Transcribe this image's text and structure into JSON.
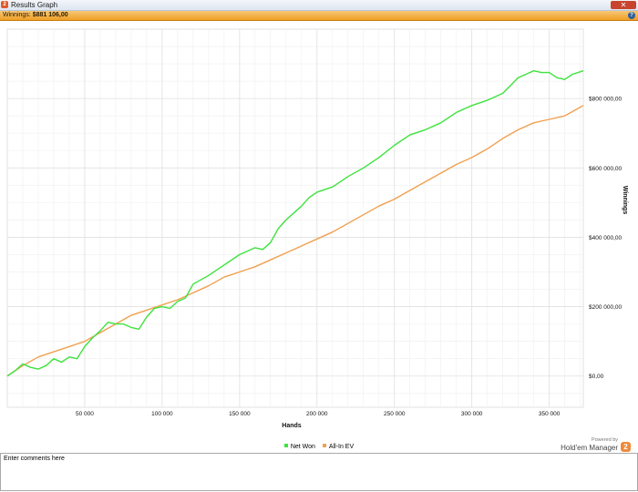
{
  "window": {
    "title": "Results Graph",
    "close_label": "✕",
    "icon_label": "2"
  },
  "info_bar": {
    "label": "Winnings:",
    "value": "$881 106,00",
    "help_label": "?"
  },
  "chart_data": {
    "type": "line",
    "xlabel": "Hands",
    "ylabel": "Winnings",
    "xlim": [
      0,
      372000
    ],
    "ylim": [
      -90000,
      1000000
    ],
    "x_ticks": [
      50000,
      100000,
      150000,
      200000,
      250000,
      300000,
      350000
    ],
    "x_tick_labels": [
      "50 000",
      "100 000",
      "150 000",
      "200 000",
      "250 000",
      "300 000",
      "350 000"
    ],
    "y_ticks": [
      0,
      200000,
      400000,
      600000,
      800000
    ],
    "y_tick_labels": [
      "$0,00",
      "$200 000,00",
      "$400 000,00",
      "$600 000,00",
      "$800 000,00"
    ],
    "y_axis_position": "right",
    "grid": true,
    "legend_position": "bottom-center",
    "series": [
      {
        "name": "Net Won",
        "color": "#3ee23e",
        "x": [
          0,
          5000,
          10000,
          15000,
          20000,
          25000,
          30000,
          35000,
          40000,
          45000,
          50000,
          55000,
          60000,
          65000,
          70000,
          75000,
          80000,
          85000,
          90000,
          95000,
          100000,
          105000,
          110000,
          115000,
          120000,
          130000,
          140000,
          150000,
          160000,
          165000,
          170000,
          175000,
          180000,
          185000,
          190000,
          195000,
          200000,
          210000,
          220000,
          230000,
          240000,
          250000,
          260000,
          270000,
          280000,
          290000,
          300000,
          310000,
          320000,
          330000,
          335000,
          340000,
          345000,
          350000,
          355000,
          360000,
          365000,
          372000
        ],
        "values": [
          0,
          15000,
          35000,
          25000,
          20000,
          30000,
          50000,
          40000,
          55000,
          50000,
          85000,
          110000,
          130000,
          155000,
          150000,
          150000,
          140000,
          135000,
          170000,
          195000,
          200000,
          195000,
          215000,
          225000,
          265000,
          290000,
          320000,
          350000,
          370000,
          365000,
          385000,
          425000,
          450000,
          470000,
          490000,
          515000,
          530000,
          545000,
          575000,
          600000,
          630000,
          665000,
          695000,
          710000,
          730000,
          760000,
          780000,
          795000,
          815000,
          860000,
          870000,
          880000,
          875000,
          875000,
          860000,
          855000,
          870000,
          880000
        ]
      },
      {
        "name": "All-In EV",
        "color": "#f0a050",
        "x": [
          0,
          10000,
          20000,
          30000,
          40000,
          50000,
          60000,
          70000,
          80000,
          90000,
          100000,
          110000,
          120000,
          130000,
          140000,
          150000,
          160000,
          170000,
          180000,
          190000,
          200000,
          210000,
          220000,
          230000,
          240000,
          250000,
          260000,
          270000,
          280000,
          290000,
          300000,
          310000,
          320000,
          330000,
          340000,
          350000,
          360000,
          366000,
          372000
        ],
        "values": [
          0,
          30000,
          55000,
          70000,
          85000,
          100000,
          125000,
          150000,
          175000,
          190000,
          205000,
          220000,
          240000,
          260000,
          285000,
          300000,
          315000,
          335000,
          355000,
          375000,
          395000,
          415000,
          440000,
          465000,
          490000,
          510000,
          535000,
          560000,
          585000,
          610000,
          630000,
          655000,
          685000,
          710000,
          730000,
          740000,
          750000,
          765000,
          780000
        ]
      }
    ]
  },
  "legend": {
    "items": [
      {
        "label": "Net Won",
        "color": "#3ee23e"
      },
      {
        "label": "All-In EV",
        "color": "#f0a050"
      }
    ]
  },
  "branding": {
    "powered_by": "Powered by",
    "product": "Hold'em Manager",
    "icon_label": "2"
  },
  "comments": {
    "placeholder": "Enter comments here"
  }
}
